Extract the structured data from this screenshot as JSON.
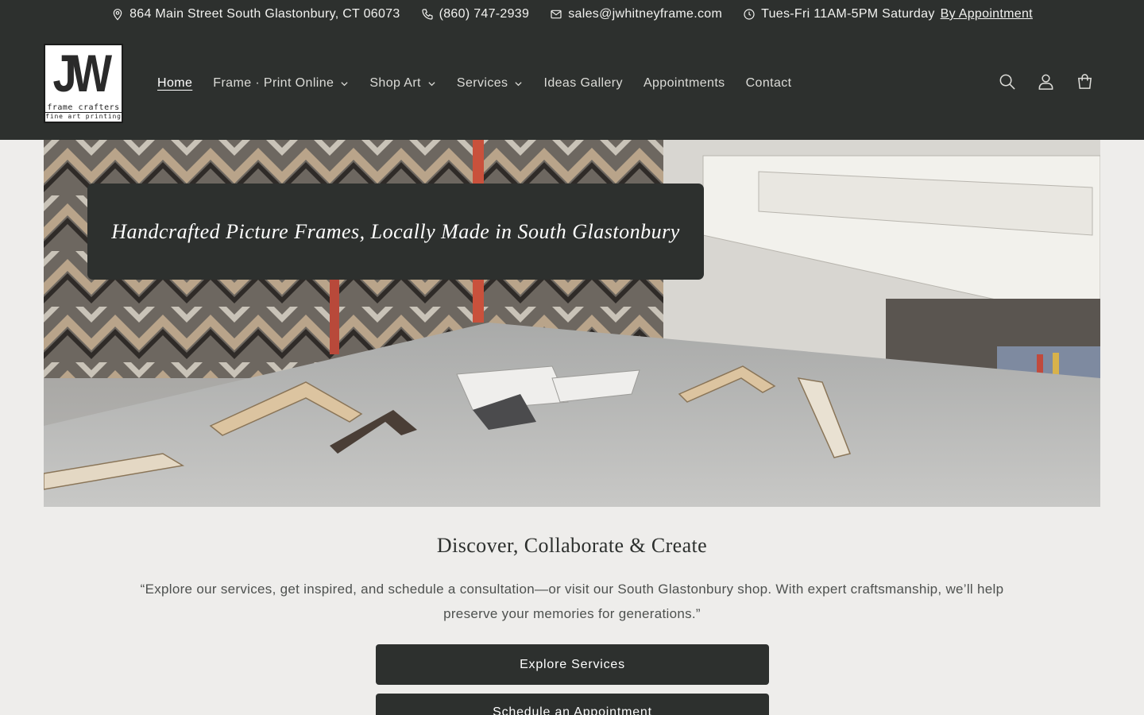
{
  "topbar": {
    "address": "864 Main Street South Glastonbury, CT 06073",
    "phone": "(860) 747-2939",
    "email": "sales@jwhitneyframe.com",
    "hours": "Tues-Fri 11AM-5PM Saturday",
    "appointment_link": "By Appointment",
    "icons": [
      "map-pin-icon",
      "phone-icon",
      "mail-icon",
      "clock-icon"
    ]
  },
  "logo": {
    "mark": "JW",
    "line1": "frame crafters",
    "line2": "fine art printing"
  },
  "nav": {
    "items": [
      {
        "label": "Home",
        "active": true,
        "dropdown": false
      },
      {
        "label": "Frame · Print Online",
        "active": false,
        "dropdown": true
      },
      {
        "label": "Shop Art",
        "active": false,
        "dropdown": true
      },
      {
        "label": "Services",
        "active": false,
        "dropdown": true
      },
      {
        "label": "Ideas Gallery",
        "active": false,
        "dropdown": false
      },
      {
        "label": "Appointments",
        "active": false,
        "dropdown": false
      },
      {
        "label": "Contact",
        "active": false,
        "dropdown": false
      }
    ]
  },
  "header_icons": [
    "search-icon",
    "account-icon",
    "cart-icon"
  ],
  "hero": {
    "title": "Handcrafted Picture Frames, Locally Made in South Glastonbury"
  },
  "intro": {
    "heading": "Discover, Collaborate & Create",
    "text": "“Explore our services, get inspired, and schedule a consultation—or visit our South Glastonbury shop. With expert craftsmanship, we’ll help preserve your memories for generations.”"
  },
  "buttons": {
    "primary": "Explore Services",
    "secondary": "Schedule an Appointment"
  },
  "colors": {
    "dark": "#2d302e",
    "background": "#eeedeb",
    "text_light": "#dcdcd8"
  }
}
